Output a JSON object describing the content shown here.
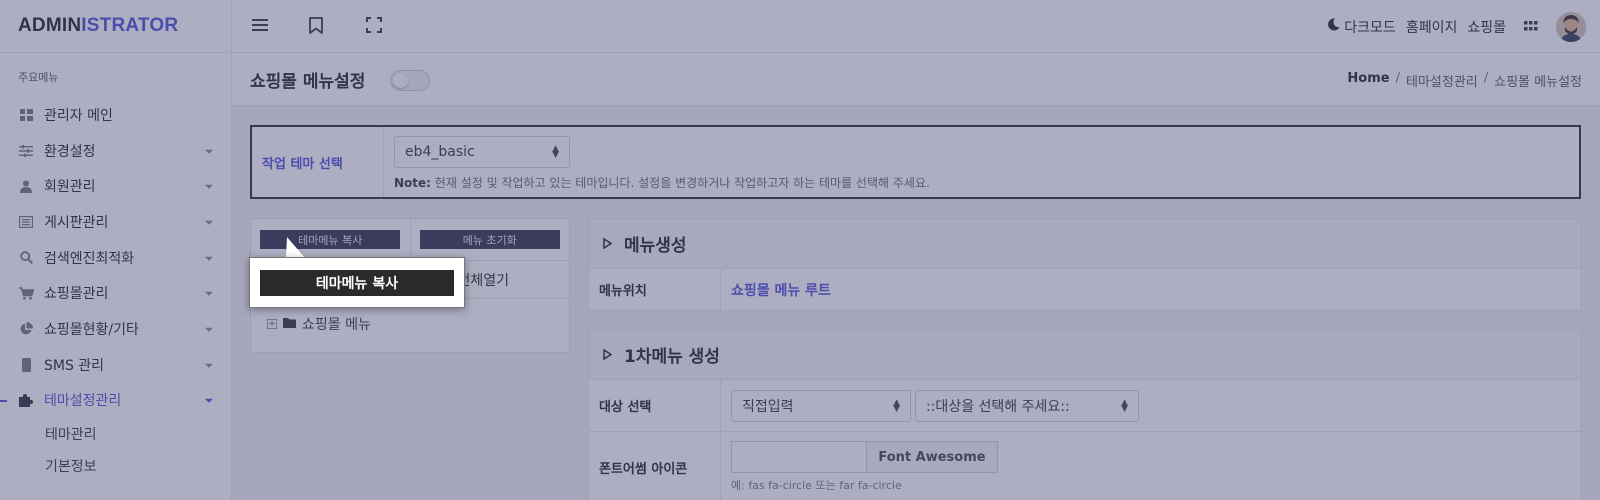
{
  "brand": {
    "part1": "ADMIN",
    "part2": "ISTRATOR"
  },
  "sidebar": {
    "section_label": "주요메뉴",
    "items": [
      {
        "label": "관리자 메인",
        "icon": "dashboard-icon",
        "has_chevron": false
      },
      {
        "label": "환경설정",
        "icon": "sliders-icon",
        "has_chevron": true
      },
      {
        "label": "회원관리",
        "icon": "user-icon",
        "has_chevron": true
      },
      {
        "label": "게시판관리",
        "icon": "list-icon",
        "has_chevron": true
      },
      {
        "label": "검색엔진최적화",
        "icon": "search-icon",
        "has_chevron": true
      },
      {
        "label": "쇼핑몰관리",
        "icon": "cart-icon",
        "has_chevron": true
      },
      {
        "label": "쇼핑몰현황/기타",
        "icon": "pie-chart-icon",
        "has_chevron": true
      },
      {
        "label": "SMS 관리",
        "icon": "mobile-icon",
        "has_chevron": true
      },
      {
        "label": "테마설정관리",
        "icon": "puzzle-icon",
        "has_chevron": true,
        "active": true
      }
    ],
    "subitems": [
      "테마관리",
      "기본정보"
    ]
  },
  "topbar": {
    "darkmode": "다크모드",
    "homepage": "홈페이지",
    "shop": "쇼핑몰"
  },
  "page": {
    "title": "쇼핑몰 메뉴설정",
    "breadcrumb": [
      "Home",
      "테마설정관리",
      "쇼핑몰 메뉴설정"
    ]
  },
  "theme_select": {
    "label": "작업 테마 선택",
    "value": "eb4_basic",
    "note_prefix": "Note:",
    "note": "현재 설정 및 작업하고 있는 테마입니다. 설정을 변경하거나 작업하고자 하는 테마를 선택해 주세요."
  },
  "tree": {
    "copy_button": "테마메뉴 복사",
    "reset_button": "메뉴 초기화",
    "expand_all": "전체열기",
    "root_node": "쇼핑몰 메뉴"
  },
  "tooltip": {
    "text": "테마메뉴 복사"
  },
  "menu_create": {
    "title": "메뉴생성",
    "position_label": "메뉴위치",
    "position_value": "쇼핑몰 메뉴 루트"
  },
  "first_menu": {
    "title": "1차메뉴 생성",
    "target_label": "대상 선택",
    "target_select": "직접입력",
    "target_select2": "::대상을 선택해 주세요::",
    "icon_label": "폰트어썸 아이콘",
    "fa_button": "Font Awesome",
    "hint": "예: fas fa-circle 또는 far fa-circle"
  },
  "colors": {
    "accent": "#4a4fd6",
    "overlay": "#4b4b78"
  }
}
